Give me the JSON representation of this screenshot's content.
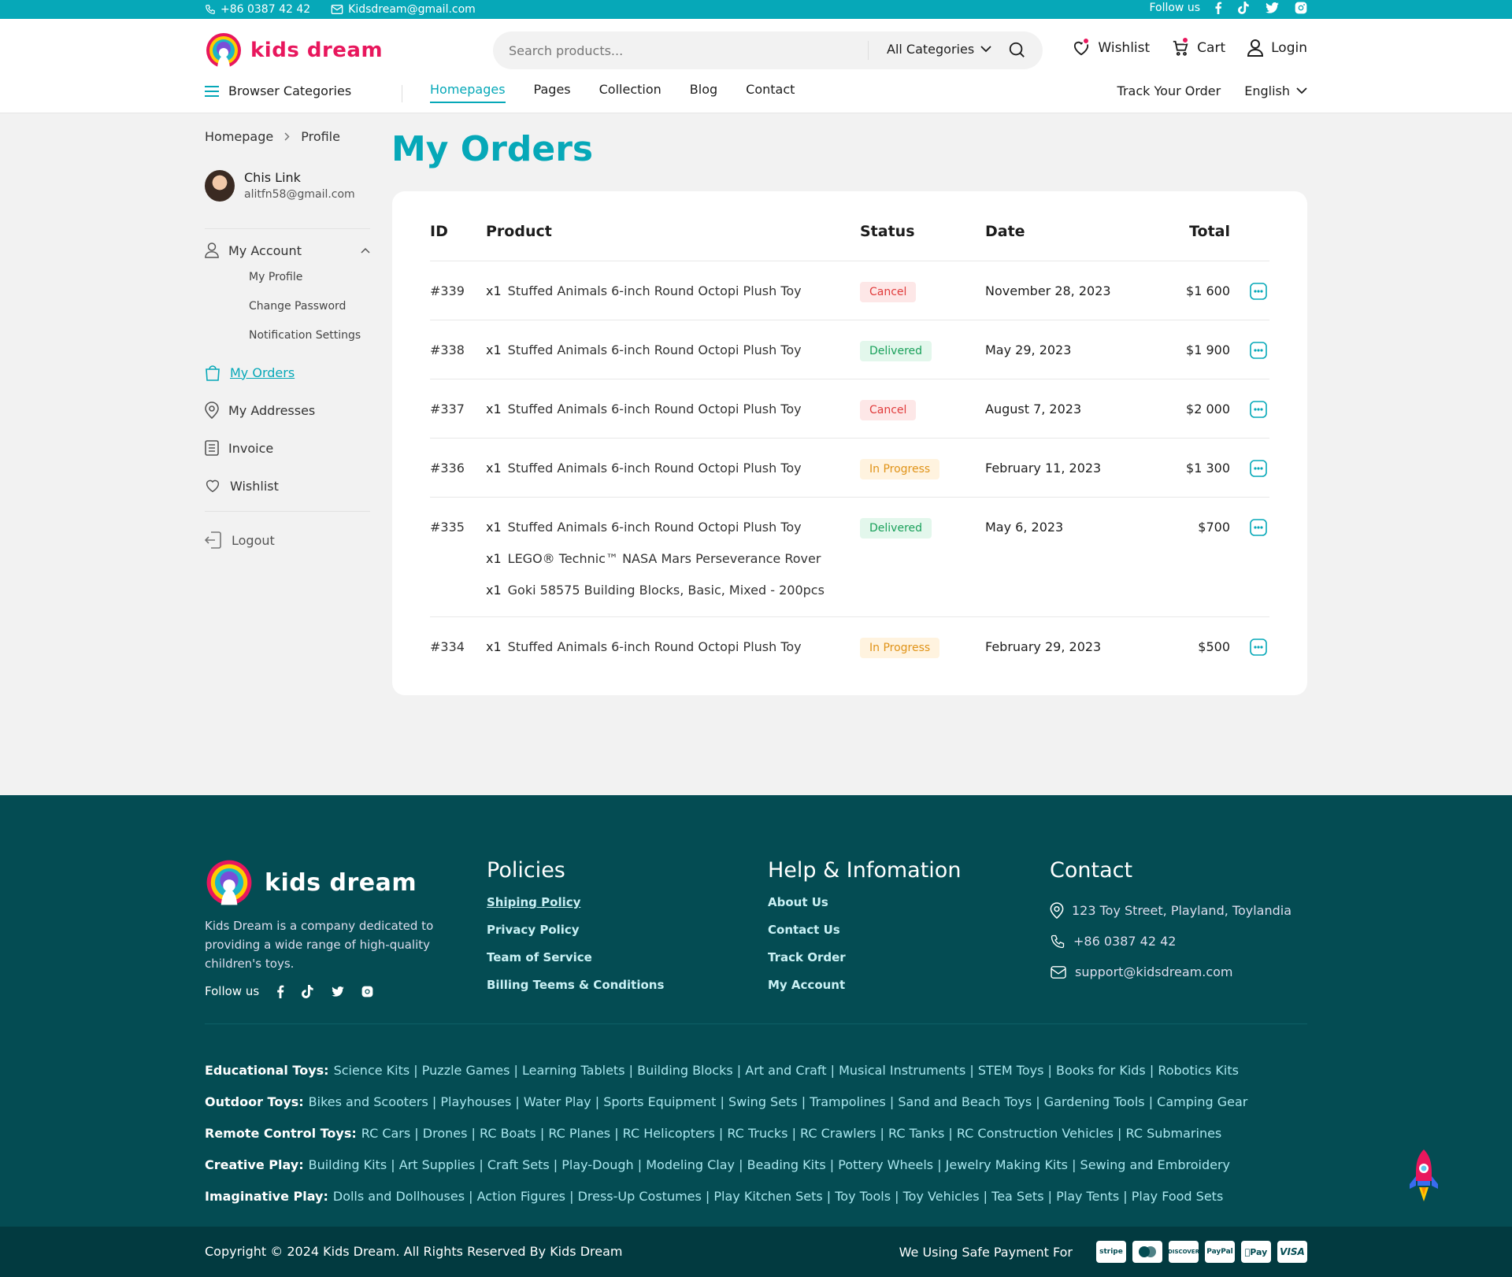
{
  "topbar": {
    "phone": "+86 0387 42 42",
    "email": "Kidsdream@gmail.com",
    "follow_label": "Follow us"
  },
  "brand": {
    "name": "kids dream",
    "accent": "#06a8b8",
    "pink": "#e8175d"
  },
  "search": {
    "placeholder": "Search products...",
    "category": "All Categories"
  },
  "actions": {
    "wishlist": "Wishlist",
    "cart": "Cart",
    "login": "Login"
  },
  "nav": {
    "browse": "Browser Categories",
    "items": [
      "Homepages",
      "Pages",
      "Collection",
      "Blog",
      "Contact"
    ],
    "track": "Track Your Order",
    "language": "English"
  },
  "breadcrumb": {
    "home": "Homepage",
    "current": "Profile"
  },
  "user": {
    "name": "Chis Link",
    "email": "alitfn58@gmail.com"
  },
  "sidebar": {
    "account": "My Account",
    "sub": [
      "My Profile",
      "Change Password",
      "Notification Settings"
    ],
    "orders": "My Orders",
    "addresses": "My Addresses",
    "invoice": "Invoice",
    "wishlist": "Wishlist",
    "logout": "Logout"
  },
  "page": {
    "title": "My Orders"
  },
  "table": {
    "headers": {
      "id": "ID",
      "product": "Product",
      "status": "Status",
      "date": "Date",
      "total": "Total"
    },
    "rows": [
      {
        "id": "#339",
        "items": [
          {
            "qty": "x1",
            "name": "Stuffed Animals 6-inch Round Octopi Plush Toy"
          }
        ],
        "status": "Cancel",
        "date": "November 28, 2023",
        "total": "$1 600"
      },
      {
        "id": "#338",
        "items": [
          {
            "qty": "x1",
            "name": "Stuffed Animals 6-inch Round Octopi Plush Toy"
          }
        ],
        "status": "Delivered",
        "date": "May 29, 2023",
        "total": "$1 900"
      },
      {
        "id": "#337",
        "items": [
          {
            "qty": "x1",
            "name": "Stuffed Animals 6-inch Round Octopi Plush Toy"
          }
        ],
        "status": "Cancel",
        "date": "August 7, 2023",
        "total": "$2 000"
      },
      {
        "id": "#336",
        "items": [
          {
            "qty": "x1",
            "name": "Stuffed Animals 6-inch Round Octopi Plush Toy"
          }
        ],
        "status": "In Progress",
        "date": "February 11, 2023",
        "total": "$1 300"
      },
      {
        "id": "#335",
        "items": [
          {
            "qty": "x1",
            "name": "Stuffed Animals 6-inch Round Octopi Plush Toy"
          },
          {
            "qty": "x1",
            "name": "LEGO® Technic™ NASA Mars Perseverance Rover"
          },
          {
            "qty": "x1",
            "name": "Goki 58575 Building Blocks, Basic, Mixed - 200pcs"
          }
        ],
        "status": "Delivered",
        "date": "May 6, 2023",
        "total": "$700"
      },
      {
        "id": "#334",
        "items": [
          {
            "qty": "x1",
            "name": "Stuffed Animals 6-inch Round Octopi Plush Toy"
          }
        ],
        "status": "In Progress",
        "date": "February 29, 2023",
        "total": "$500"
      }
    ]
  },
  "footer": {
    "description": "Kids Dream is a company dedicated to providing a wide range of high-quality children's toys.",
    "follow": "Follow us",
    "policies": {
      "title": "Policies",
      "links": [
        "Shiping Policy",
        "Privacy Policy",
        "Team of Service",
        "Billing Teems & Conditions"
      ]
    },
    "help": {
      "title": "Help & Infomation",
      "links": [
        "About Us",
        "Contact Us",
        "Track Order",
        "My Account"
      ]
    },
    "contact": {
      "title": "Contact",
      "address": "123 Toy Street, Playland, Toylandia",
      "phone": "+86 0387 42 42",
      "email": "support@kidsdream.com"
    },
    "categories": [
      {
        "label": "Educational Toys:",
        "list": "Science Kits | Puzzle Games | Learning Tablets | Building Blocks | Art and Craft | Musical Instruments | STEM Toys | Books for Kids | Robotics Kits"
      },
      {
        "label": "Outdoor Toys:",
        "list": "Bikes and Scooters | Playhouses | Water Play | Sports Equipment | Swing Sets | Trampolines | Sand and Beach Toys | Gardening Tools | Camping Gear"
      },
      {
        "label": "Remote Control Toys:",
        "list": "RC Cars | Drones | RC Boats | RC Planes | RC Helicopters | RC Trucks | RC Crawlers | RC Tanks | RC Construction Vehicles | RC Submarines"
      },
      {
        "label": "Creative Play:",
        "list": "Building Kits | Art Supplies | Craft Sets | Play-Dough | Modeling Clay | Beading Kits | Pottery Wheels | Jewelry Making Kits | Sewing and Embroidery"
      },
      {
        "label": "Imaginative Play:",
        "list": "Dolls and Dollhouses | Action Figures | Dress-Up Costumes | Play Kitchen Sets | Toy Tools | Toy Vehicles | Tea Sets | Play Tents | Play Food Sets"
      }
    ],
    "copyright": "Copyright © 2024 Kids Dream. All Rights Reserved By Kids Dream",
    "payment_label": "We Using Safe Payment For",
    "payment_methods": [
      "stripe",
      "mastercard",
      "DISCOVER",
      "PayPal",
      "Pay",
      "VISA"
    ]
  }
}
